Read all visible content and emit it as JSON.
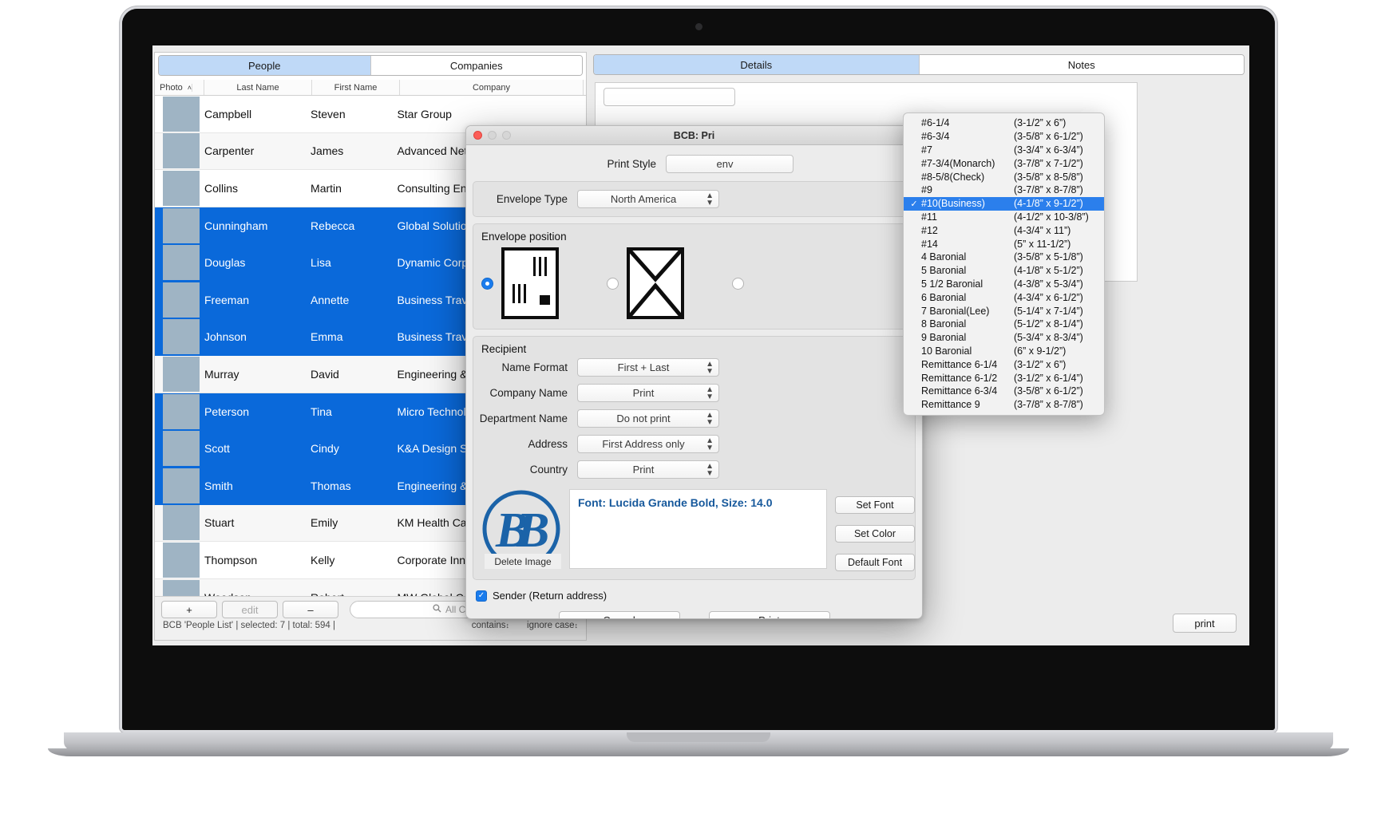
{
  "app": {
    "left": {
      "tabs": [
        {
          "label": "People",
          "active": true
        },
        {
          "label": "Companies",
          "active": false
        }
      ],
      "columns": [
        "Photo",
        "Last Name",
        "First Name",
        "Company"
      ],
      "sort_indicator": "˄",
      "rows": [
        {
          "last": "Campbell",
          "first": "Steven",
          "company": "Star Group",
          "selected": false
        },
        {
          "last": "Carpenter",
          "first": "James",
          "company": "Advanced Networ",
          "selected": false
        },
        {
          "last": "Collins",
          "first": "Martin",
          "company": "Consulting Engine",
          "selected": false
        },
        {
          "last": "Cunningham",
          "first": "Rebecca",
          "company": "Global Solutions,",
          "selected": true
        },
        {
          "last": "Douglas",
          "first": "Lisa",
          "company": "Dynamic Corporat",
          "selected": true
        },
        {
          "last": "Freeman",
          "first": "Annette",
          "company": "Business Travel",
          "selected": true
        },
        {
          "last": "Johnson",
          "first": "Emma",
          "company": "Business Travel",
          "selected": true
        },
        {
          "last": "Murray",
          "first": "David",
          "company": "Engineering & Ma",
          "selected": false
        },
        {
          "last": "Peterson",
          "first": "Tina",
          "company": "Micro Technologie",
          "selected": true
        },
        {
          "last": "Scott",
          "first": "Cindy",
          "company": "K&A Design Studi",
          "selected": true
        },
        {
          "last": "Smith",
          "first": "Thomas",
          "company": "Engineering & Ma",
          "selected": true
        },
        {
          "last": "Stuart",
          "first": "Emily",
          "company": "KM Health Care",
          "selected": false
        },
        {
          "last": "Thompson",
          "first": "Kelly",
          "company": "Corporate Innovat",
          "selected": false
        },
        {
          "last": "Woodson",
          "first": "Robert",
          "company": "MW Global Consulting",
          "selected": false
        }
      ],
      "toolbar": {
        "add_label": "+",
        "edit_label": "edit",
        "remove_label": "–",
        "search_placeholder": "All Columns",
        "search_icon": "search-icon"
      },
      "status": {
        "text": "BCB 'People List'  |  selected: 7  |  total: 594  |",
        "match_mode": "contains",
        "case_mode": "ignore case"
      }
    },
    "right": {
      "tabs": [
        {
          "label": "Details",
          "active": true
        },
        {
          "label": "Notes",
          "active": false
        }
      ],
      "print_button": "print"
    }
  },
  "dialog": {
    "title": "BCB: Pri",
    "print_style": {
      "label": "Print Style",
      "value": "env"
    },
    "envelope_type": {
      "label": "Envelope Type",
      "value": "North America"
    },
    "envelope_position": {
      "title": "Envelope position",
      "options": [
        {
          "name": "lines-left-stamp",
          "selected": true
        },
        {
          "name": "envelope-flap-x",
          "selected": false
        },
        {
          "name": "third-option",
          "selected": false
        }
      ]
    },
    "recipient": {
      "title": "Recipient",
      "fields": [
        {
          "label": "Name Format",
          "value": "First + Last"
        },
        {
          "label": "Company Name",
          "value": "Print"
        },
        {
          "label": "Department Name",
          "value": "Do not print"
        },
        {
          "label": "Address",
          "value": "First Address only"
        },
        {
          "label": "Country",
          "value": "Print"
        }
      ]
    },
    "font_preview": "Font: Lucida Grande Bold, Size: 14.0",
    "delete_image_label": "Delete Image",
    "font_buttons": [
      "Set Font",
      "Set Color",
      "Default Font"
    ],
    "sender_checkbox": {
      "label": "Sender (Return address)",
      "checked": true,
      "mark": "✓"
    },
    "footer": {
      "cancel": "Cancel",
      "print": "Print"
    },
    "accent_color": "#1a7ced",
    "logo_color": "#1b63a8"
  },
  "menu": {
    "selected_index": 6,
    "check_mark": "✓",
    "items": [
      {
        "name": "#6-1/4",
        "size": "(3-1/2” x 6”)"
      },
      {
        "name": "#6-3/4",
        "size": " (3-5/8” x 6-1/2”)"
      },
      {
        "name": "#7",
        "size": "(3-3/4” x 6-3/4”)"
      },
      {
        "name": "#7-3/4(Monarch)",
        "size": "(3-7/8” x 7-1/2”)"
      },
      {
        "name": "#8-5/8(Check)",
        "size": "(3-5/8” x 8-5/8”)"
      },
      {
        "name": "#9",
        "size": "(3-7/8” x 8-7/8”)"
      },
      {
        "name": "#10(Business)",
        "size": "(4-1/8” x 9-1/2”)"
      },
      {
        "name": "#11",
        "size": "(4-1/2” x 10-3/8”)"
      },
      {
        "name": "#12",
        "size": "(4-3/4” x 11”)"
      },
      {
        "name": "#14",
        "size": "(5” x 11-1/2”)"
      },
      {
        "name": "4 Baronial",
        "size": "(3-5/8” x 5-1/8”)"
      },
      {
        "name": "5 Baronial",
        "size": "(4-1/8” x 5-1/2”)"
      },
      {
        "name": "5 1/2 Baronial",
        "size": "(4-3/8” x 5-3/4”)"
      },
      {
        "name": "6 Baronial",
        "size": "(4-3/4” x 6-1/2”)"
      },
      {
        "name": "7 Baronial(Lee)",
        "size": "(5-1/4” x 7-1/4”)"
      },
      {
        "name": "8 Baronial",
        "size": "(5-1/2” x 8-1/4”)"
      },
      {
        "name": "9 Baronial",
        "size": "(5-3/4” x 8-3/4”)"
      },
      {
        "name": "10 Baronial",
        "size": "(6” x 9-1/2”)"
      },
      {
        "name": "Remittance 6-1/4",
        "size": "(3-1/2” x 6”)"
      },
      {
        "name": "Remittance 6-1/2",
        "size": "(3-1/2” x 6-1/4”)"
      },
      {
        "name": "Remittance 6-3/4",
        "size": "(3-5/8” x 6-1/2”)"
      },
      {
        "name": "Remittance 9",
        "size": "(3-7/8” x 8-7/8”)"
      }
    ]
  }
}
